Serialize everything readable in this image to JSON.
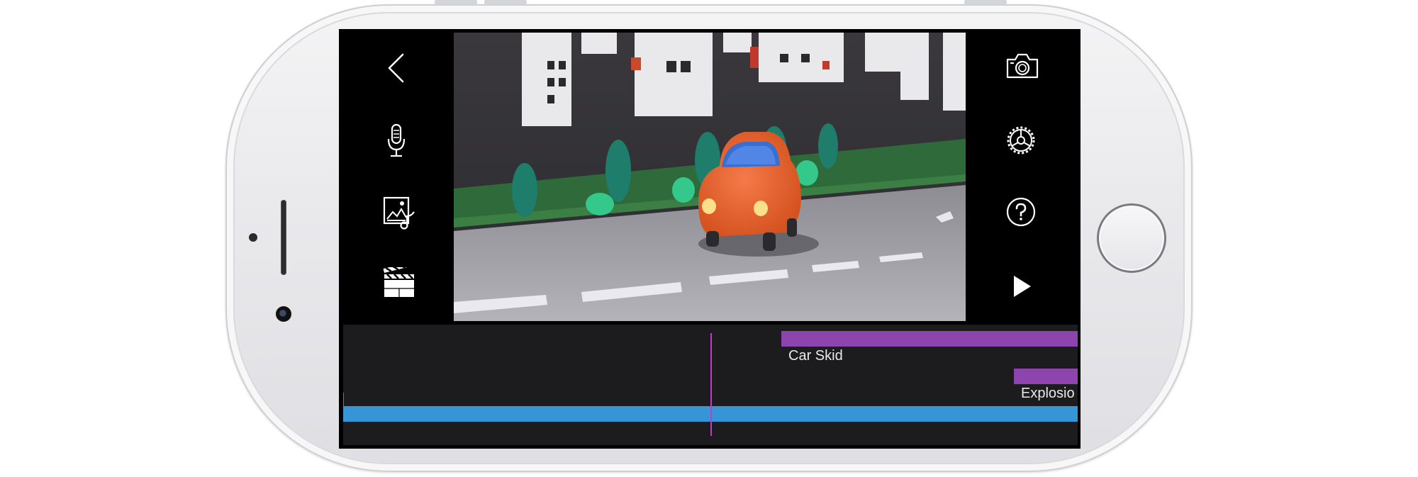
{
  "timeline": {
    "clips": [
      {
        "label": "Car Skid"
      },
      {
        "label": "Explosio"
      }
    ]
  },
  "icons": {
    "back": "chevron-left-icon",
    "mic": "microphone-icon",
    "image": "image-sound-icon",
    "clapper": "clapperboard-icon",
    "camera": "camera-icon",
    "settings": "gear-icon",
    "help": "help-icon",
    "play": "play-icon"
  },
  "colors": {
    "clip": "#8e44ad",
    "video_track": "#3595d6",
    "playhead": "#c23cc9",
    "timeline_bg": "#1c1c1e",
    "phone_body": "#ececef"
  }
}
